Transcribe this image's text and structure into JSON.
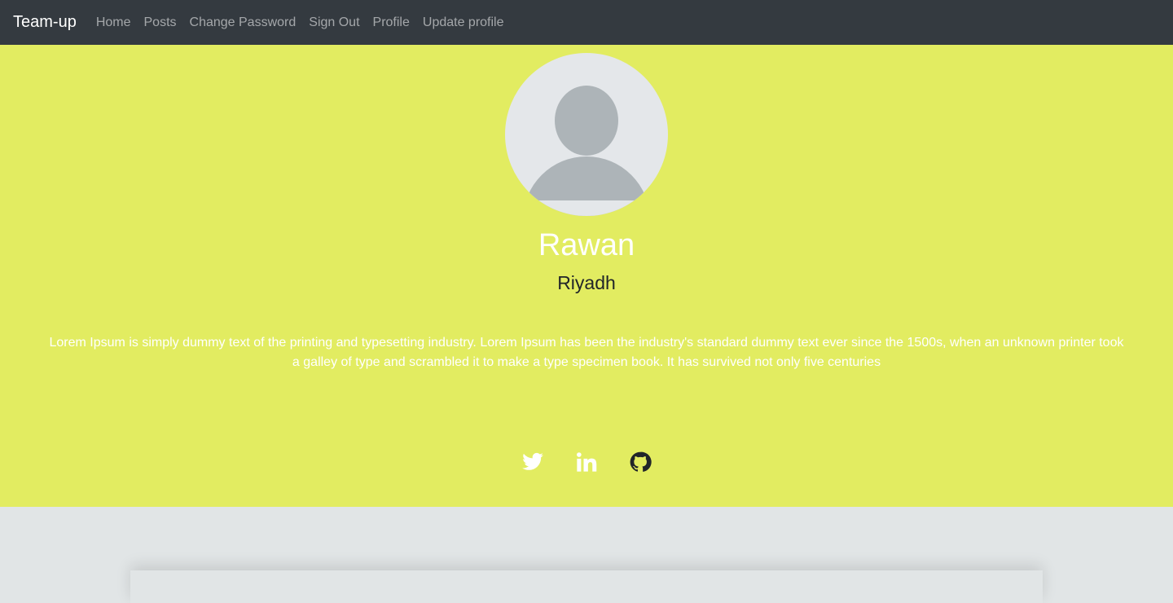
{
  "navbar": {
    "brand": "Team-up",
    "links": [
      "Home",
      "Posts",
      "Change Password",
      "Sign Out",
      "Profile",
      "Update profile"
    ]
  },
  "profile": {
    "name": "Rawan",
    "city": "Riyadh",
    "bio": "Lorem Ipsum is simply dummy text of the printing and typesetting industry. Lorem Ipsum has been the industry's standard dummy text ever since the 1500s, when an unknown printer took a galley of type and scrambled it to make a type specimen book. It has survived not only five centuries",
    "social": [
      "twitter-icon",
      "linkedin-icon",
      "github-icon"
    ]
  },
  "colors": {
    "navbar_bg": "#343a40",
    "hero_bg": "#e2ec61",
    "page_bg": "#e1e5e6",
    "avatar_bg": "#e4e7ea",
    "avatar_fg": "#adb4b8"
  }
}
